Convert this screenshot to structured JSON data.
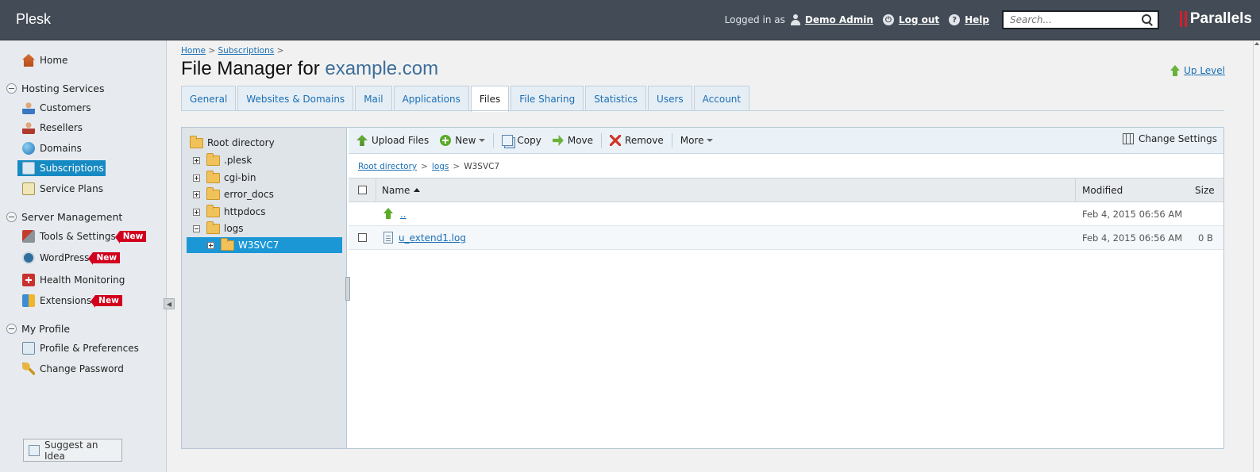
{
  "header": {
    "brand": "Plesk",
    "logged_in_label": "Logged in as",
    "user": "Demo Admin",
    "logout": "Log out",
    "help": "Help",
    "search_placeholder": "Search...",
    "vendor": "Parallels"
  },
  "sidebar": {
    "home": "Home",
    "sections": [
      {
        "title": "Hosting Services",
        "items": [
          "Customers",
          "Resellers",
          "Domains",
          "Subscriptions",
          "Service Plans"
        ]
      },
      {
        "title": "Server Management",
        "items": [
          "Tools & Settings",
          "WordPress",
          "Health Monitoring",
          "Extensions"
        ]
      },
      {
        "title": "My Profile",
        "items": [
          "Profile & Preferences",
          "Change Password"
        ]
      }
    ],
    "new_badge": "New",
    "suggest": "Suggest an Idea"
  },
  "breadcrumb": {
    "items": [
      "Home",
      "Subscriptions"
    ],
    "sep": ">"
  },
  "page": {
    "title_prefix": "File Manager for",
    "domain": "example.com",
    "up_level": "Up Level"
  },
  "tabs": [
    "General",
    "Websites & Domains",
    "Mail",
    "Applications",
    "Files",
    "File Sharing",
    "Statistics",
    "Users",
    "Account"
  ],
  "tree": {
    "root": "Root directory",
    "items": [
      ".plesk",
      "cgi-bin",
      "error_docs",
      "httpdocs",
      "logs"
    ],
    "selected": "W3SVC7"
  },
  "toolbar": {
    "upload": "Upload Files",
    "new": "New",
    "copy": "Copy",
    "move": "Move",
    "remove": "Remove",
    "more": "More",
    "change_settings": "Change Settings"
  },
  "path": {
    "items": [
      "Root directory",
      "logs"
    ],
    "current": "W3SVC7",
    "sep": ">"
  },
  "grid": {
    "columns": {
      "name": "Name",
      "modified": "Modified",
      "size": "Size"
    },
    "rows": [
      {
        "name": "..",
        "modified": "Feb 4, 2015 06:56 AM",
        "size": ""
      },
      {
        "name": "u_extend1.log",
        "modified": "Feb 4, 2015 06:56 AM",
        "size": "0 B"
      }
    ]
  },
  "colors": {
    "accent": "#168ac3",
    "topbar": "#434c56",
    "badge": "#d2001e"
  }
}
